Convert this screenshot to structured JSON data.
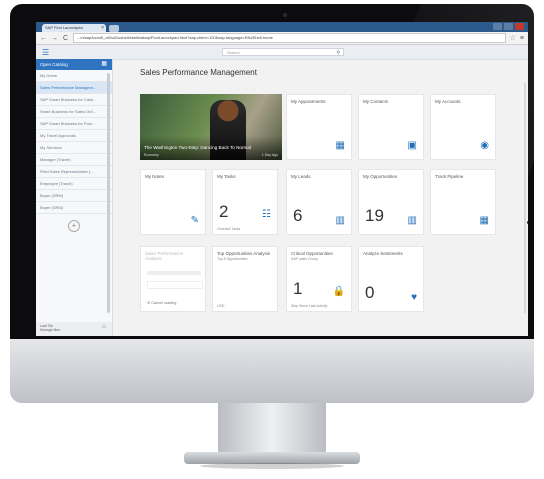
{
  "browser": {
    "tab_title": "SAP Fiori Launchpad",
    "tab_close": "×",
    "url": "...m/sap/bc/ui5_ui5/ui2/ushell/shells/abap/FioriLaunchpad.html?sap-client=120&sap-language=EN#Shell-home",
    "back": "←",
    "forward": "→",
    "reload": "C",
    "star": "☆"
  },
  "shell": {
    "menu_glyph": "☰",
    "search_placeholder": "Search",
    "search_glyph": "⚲"
  },
  "sidebar": {
    "catalog_button": "Open Catalog",
    "catalog_glyph": "▦",
    "items": [
      {
        "label": "My Home"
      },
      {
        "label": "Sales Performance Managem..."
      },
      {
        "label": "SAP Smart Business for Cash..."
      },
      {
        "label": "Smart Business for Sales Ord..."
      },
      {
        "label": "SAP Smart Business for Purc..."
      },
      {
        "label": "My Travel Approvals"
      },
      {
        "label": "My Services"
      },
      {
        "label": "Manager (Travel)"
      },
      {
        "label": "Field Sales Representative (..."
      },
      {
        "label": "Employee (Travel)"
      },
      {
        "label": "Buyer (SRM)"
      },
      {
        "label": "Buyer (SRM)"
      }
    ],
    "plus_glyph": "+",
    "footer_line1": "Last Tile",
    "footer_line2": "Manage tiles",
    "footer_glyph": "⌂"
  },
  "main": {
    "page_title": "Sales Performance Management",
    "news": {
      "title": "The Washington Two-Step: Dancing Back To Normal",
      "source": "Economy",
      "time": "1 Day Ago"
    },
    "tiles": [
      {
        "title": "My Appointments",
        "icon": "calendar-icon",
        "glyph": "▦"
      },
      {
        "title": "My Contacts",
        "icon": "contact-card-icon",
        "glyph": "▣"
      },
      {
        "title": "My Accounts",
        "icon": "account-icon",
        "glyph": "◉"
      },
      {
        "title": "My Notes",
        "icon": "note-icon",
        "glyph": "✎"
      },
      {
        "title": "My Tasks",
        "number": "2",
        "footer": "Overdue Tasks",
        "icon": "task-list-icon",
        "glyph": "☷"
      },
      {
        "title": "My Leads",
        "number": "6",
        "icon": "leads-chart-icon",
        "glyph": "▥"
      },
      {
        "title": "My Opportunities",
        "number": "19",
        "icon": "opportunities-chart-icon",
        "glyph": "▥"
      },
      {
        "title": "Track Pipeline",
        "icon": "pipeline-icon",
        "glyph": "▦"
      },
      {
        "title": "Sales Performance Analysis",
        "cancel_label": "Cancel loading",
        "cancel_glyph": "⊘"
      },
      {
        "title": "Top Opportunities Analysis",
        "subtitle": "Top 5 Opportunities",
        "footer": "USD"
      },
      {
        "title": "Critical Opportunities",
        "subtitle": "SAP sales Group",
        "number": "1",
        "footer": "Stop Since Last Activity",
        "icon": "lock-icon",
        "glyph": "🔒"
      },
      {
        "title": "Analyze Sentiments",
        "number": "0",
        "icon": "heart-icon",
        "glyph": "♥"
      }
    ]
  }
}
